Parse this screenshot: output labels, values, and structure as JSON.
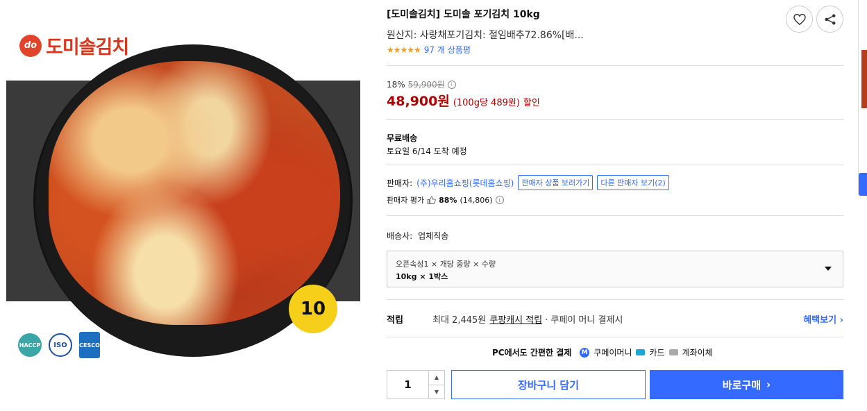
{
  "image": {
    "brand_mark": "do",
    "brand_name": "도미솔김치",
    "size_badge": "10",
    "certs": [
      "HACCP",
      "ISO",
      "CESCO"
    ]
  },
  "product": {
    "title": "[도미솔김치] 도미솔 포기김치 10kg",
    "origin": "원산지: 사랑채포기김치: 절임배추72.86%[배...",
    "stars": "★★★★★",
    "review_count": "97 개 상품평"
  },
  "price": {
    "discount_rate": "18%",
    "original": "59,900원",
    "sale": "48,900원",
    "unit": "(100g당 489원)",
    "discount_word": "할인"
  },
  "shipping": {
    "label": "무료배송",
    "date": "토요일 6/14 도착 예정"
  },
  "seller": {
    "label": "판매자:",
    "name": "(주)우리홈쇼핑(롯데홈쇼핑)",
    "view_products": "판매자 상품 보러가기",
    "other_sellers": "다른 판매자 보기(2)",
    "rating_label": "판매자 평가",
    "rating_pct": "88%",
    "rating_count": "(14,806)"
  },
  "carrier": {
    "label": "배송사:",
    "value": "업체직송"
  },
  "option": {
    "label": "오픈속성1 × 개당 중량 × 수량",
    "value": "10kg × 1박스"
  },
  "points": {
    "title": "적립",
    "text": "최대 2,445원",
    "link": "쿠팡캐시 적립",
    "suffix": "· 쿠페이 머니 결제시",
    "benefit": "혜택보기 ›"
  },
  "payment": {
    "title": "PC에서도 간편한 결제",
    "methods": [
      "쿠페이머니",
      "카드",
      "계좌이체"
    ]
  },
  "actions": {
    "quantity": "1",
    "cart": "장바구니 담기",
    "buy": "바로구매",
    "buy_arrow": "›"
  },
  "colors": {
    "accent": "#346aff",
    "price": "#ae0000",
    "star": "#f29e1f",
    "brand": "#d8351d"
  }
}
